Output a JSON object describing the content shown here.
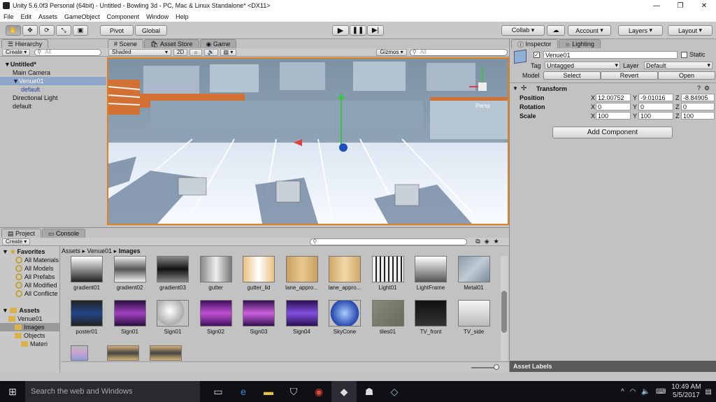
{
  "window": {
    "title": "Unity 5.6.0f3 Personal (64bit) - Untitled - Bowling 3d - PC, Mac & Linux Standalone* <DX11>"
  },
  "menu": [
    "File",
    "Edit",
    "Assets",
    "GameObject",
    "Component",
    "Window",
    "Help"
  ],
  "toolbar": {
    "pivot": "Pivot",
    "global": "Global",
    "collab": "Collab ▾",
    "account": "Account",
    "layers": "Layers",
    "layout": "Layout"
  },
  "hierarchy": {
    "tab": "Hierarchy",
    "create": "Create ▾",
    "search_placeholder": "All",
    "items": [
      {
        "label": "Untitled*",
        "depth": 0,
        "bold": true
      },
      {
        "label": "Main Camera",
        "depth": 1
      },
      {
        "label": "Venue01",
        "depth": 1,
        "selected": true
      },
      {
        "label": "default",
        "depth": 2
      },
      {
        "label": "Directional Light",
        "depth": 1
      },
      {
        "label": "default",
        "depth": 1
      }
    ]
  },
  "scene": {
    "tabs": [
      "Scene",
      "Asset Store",
      "Game"
    ],
    "shading": "Shaded",
    "mode_2d": "2D",
    "gizmos": "Gizmos ▾",
    "search_placeholder": "All",
    "gizmo_label": "Persp"
  },
  "inspector": {
    "tabs": [
      "Inspector",
      "Lighting"
    ],
    "object_name": "Venue01",
    "static": "Static",
    "tag_label": "Tag",
    "tag_value": "Untagged",
    "layer_label": "Layer",
    "layer_value": "Default",
    "model_label": "Model",
    "model_buttons": [
      "Select",
      "Revert",
      "Open"
    ],
    "transform_title": "Transform",
    "position": {
      "label": "Position",
      "x": "12.00752",
      "y": "-9.01016",
      "z": "-8.84905"
    },
    "rotation": {
      "label": "Rotation",
      "x": "0",
      "y": "0",
      "z": "0"
    },
    "scale": {
      "label": "Scale",
      "x": "100",
      "y": "100",
      "z": "100"
    },
    "add_component": "Add Component",
    "asset_labels": "Asset Labels"
  },
  "project": {
    "tabs": [
      "Project",
      "Console"
    ],
    "create": "Create ▾",
    "breadcrumb": [
      "Assets",
      "Venue01",
      "Images"
    ],
    "favorites_title": "Favorites",
    "favorites": [
      "All Materials",
      "All Models",
      "All Prefabs",
      "All Modified",
      "All Conflicte"
    ],
    "assets_title": "Assets",
    "tree": [
      {
        "label": "Venue01",
        "depth": 1
      },
      {
        "label": "Images",
        "depth": 2,
        "selected": true
      },
      {
        "label": "Objects",
        "depth": 2
      },
      {
        "label": "Materi",
        "depth": 3
      }
    ],
    "assets": [
      {
        "name": "gradient01",
        "color": "linear-gradient(#fff,#222)"
      },
      {
        "name": "gradient02",
        "color": "linear-gradient(#eee,#555,#eee)"
      },
      {
        "name": "gradient03",
        "color": "linear-gradient(#888,#111,#888)"
      },
      {
        "name": "gutter",
        "color": "linear-gradient(90deg,#888,#eee,#777)"
      },
      {
        "name": "gutter_lid",
        "color": "linear-gradient(90deg,#e8c080,#fff,#e8c080)"
      },
      {
        "name": "lane_appro...",
        "color": "linear-gradient(90deg,#c8a060,#e8c890,#c8a060)"
      },
      {
        "name": "lane_appro...",
        "color": "linear-gradient(90deg,#d0a868,#f0d8a8,#d0a868)"
      },
      {
        "name": "Light01",
        "color": "repeating-linear-gradient(90deg,#eee 0 4px,#222 4px 6px)"
      },
      {
        "name": "LightFrame",
        "color": "linear-gradient(#fff,#555)"
      },
      {
        "name": "Metal01",
        "color": "linear-gradient(135deg,#8a9aa8,#c0ccd4,#7a8a96)"
      },
      {
        "name": "poster01",
        "color": "linear-gradient(#222,#224488,#222)"
      },
      {
        "name": "Sign01",
        "color": "linear-gradient(#2a1040,#a040c0,#2a1040)"
      },
      {
        "name": "Sign01",
        "color": "radial-gradient(circle at 40% 40%,#fff,#aaa 60%,#c2c2c2 62%)"
      },
      {
        "name": "Sign02",
        "color": "linear-gradient(#401060,#c050d0,#401060)"
      },
      {
        "name": "Sign03",
        "color": "linear-gradient(#301050,#d060e0,#301050)"
      },
      {
        "name": "Sign04",
        "color": "linear-gradient(#2a1050,#8050e0,#2a1050)"
      },
      {
        "name": "SkyCone",
        "color": "radial-gradient(circle,#aaccff,#2244aa 70%,#c2c2c2 72%)"
      },
      {
        "name": "tiles01",
        "color": "linear-gradient(135deg,#8a8a7a,#6a6a5a)"
      },
      {
        "name": "TV_front",
        "color": "linear-gradient(#111,#333)"
      },
      {
        "name": "TV_side",
        "color": "linear-gradient(#f4f4f4,#bbb)"
      }
    ]
  },
  "taskbar": {
    "search": "Search the web and Windows",
    "time": "10:49 AM",
    "date": "5/5/2017"
  }
}
